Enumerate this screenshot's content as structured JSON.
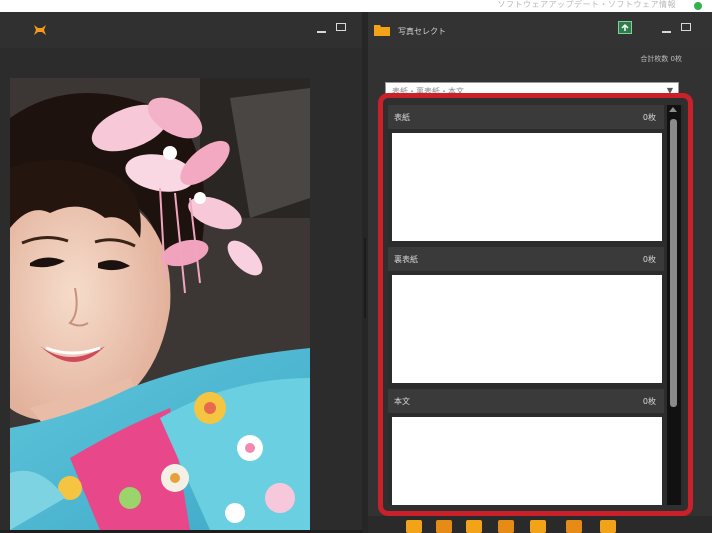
{
  "top_strip": {
    "text": "ソフトウェアアップデート・ソフトウェア情報",
    "status_color": "#2fb34a"
  },
  "viewer": {
    "app_icon": "orange-cross-icon",
    "accent": "#f59b1c",
    "photo": "portrait of a woman in a light blue floral kimono with a pink flower hair ornament"
  },
  "side_panel": {
    "title": "写真セレクト",
    "folder_icon": "folder-icon",
    "folder_color": "#f2a318",
    "export_icon": "export-icon",
    "count_label": "合計枚数 0枚",
    "selector_value": "表紙・裏表紙・本文",
    "groups": [
      {
        "name": "表紙",
        "count": "0枚"
      },
      {
        "name": "裏表紙",
        "count": "0枚"
      },
      {
        "name": "本文",
        "count": "0枚"
      }
    ]
  },
  "highlight_color": "#c9202a"
}
